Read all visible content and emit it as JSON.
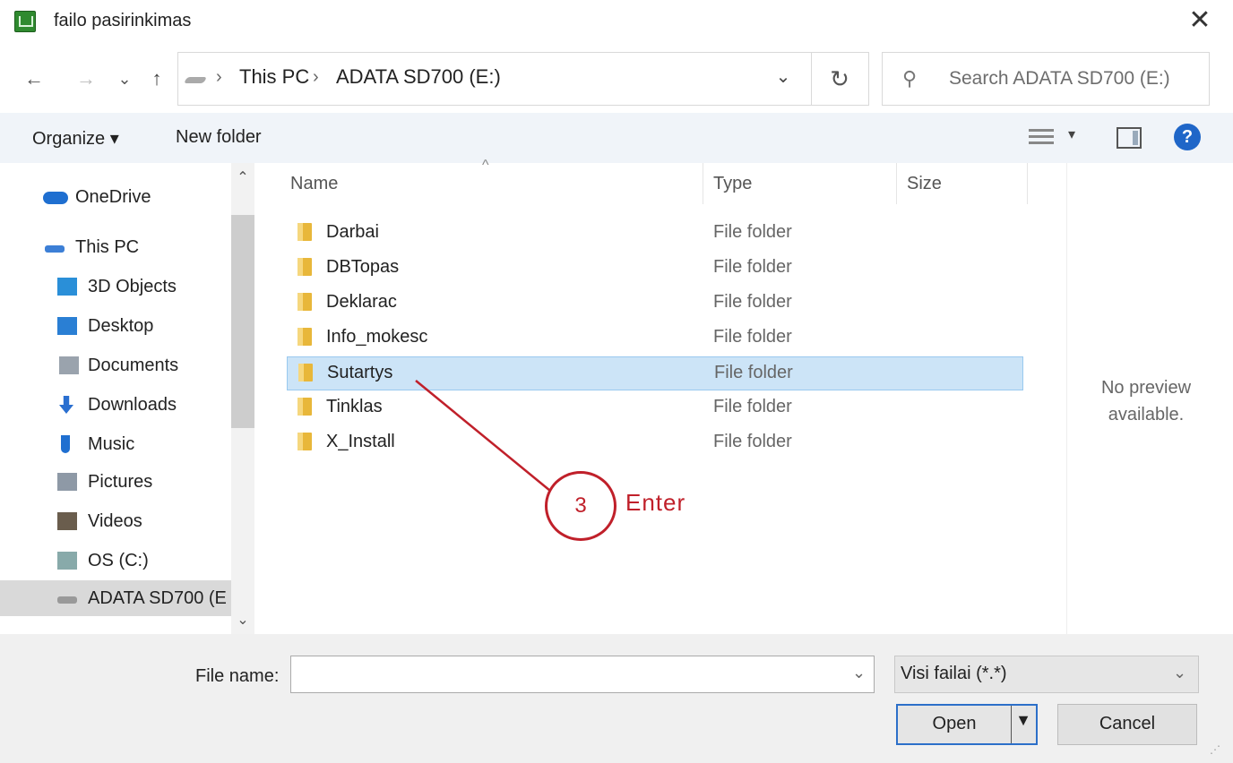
{
  "window": {
    "title": "failo pasirinkimas",
    "close_glyph": "✕"
  },
  "nav": {
    "back_glyph": "←",
    "forward_glyph": "→",
    "recent_glyph": "⌄",
    "up_glyph": "↑",
    "breadcrumbs": [
      "This PC",
      "ADATA SD700 (E:)"
    ],
    "separator": "›",
    "dropdown_glyph": "⌄",
    "refresh_glyph": "↻",
    "search_placeholder": "Search ADATA SD700 (E:)",
    "search_glyph": "⚲"
  },
  "toolbar": {
    "organize_label": "Organize ▾",
    "new_folder_label": "New folder",
    "view_drop_glyph": "▾",
    "help_label": "?"
  },
  "sidebar": {
    "items": [
      {
        "label": "OneDrive",
        "icon": "cloud-icon",
        "color": "#1f6fd0"
      },
      {
        "label": "This PC",
        "icon": "pc-icon",
        "color": "#3c7fd6"
      },
      {
        "label": "3D Objects",
        "icon": "cube-icon",
        "color": "#2a8fd8"
      },
      {
        "label": "Desktop",
        "icon": "desktop-icon",
        "color": "#2a7fd4"
      },
      {
        "label": "Documents",
        "icon": "document-icon",
        "color": "#9aa3ad"
      },
      {
        "label": "Downloads",
        "icon": "download-icon",
        "color": "#2a6fd0"
      },
      {
        "label": "Music",
        "icon": "music-icon",
        "color": "#1f6fd0"
      },
      {
        "label": "Pictures",
        "icon": "pictures-icon",
        "color": "#8e99a6"
      },
      {
        "label": "Videos",
        "icon": "videos-icon",
        "color": "#6a5d4d"
      },
      {
        "label": "OS (C:)",
        "icon": "drive-c-icon",
        "color": "#8aa"
      },
      {
        "label": "ADATA SD700 (E",
        "icon": "drive-e-icon",
        "color": "#999"
      }
    ],
    "scroll_up": "⌃",
    "scroll_down": "⌄"
  },
  "filelist": {
    "columns": [
      "Name",
      "Type",
      "Size"
    ],
    "sort_caret": "^",
    "rows": [
      {
        "name": "Darbai",
        "type": "File folder"
      },
      {
        "name": "DBTopas",
        "type": "File folder"
      },
      {
        "name": "Deklarac",
        "type": "File folder"
      },
      {
        "name": "Info_mokesc",
        "type": "File folder"
      },
      {
        "name": "Sutartys",
        "type": "File folder",
        "selected": true
      },
      {
        "name": "Tinklas",
        "type": "File folder"
      },
      {
        "name": "X_Install",
        "type": "File folder"
      }
    ],
    "preview_text_1": "No preview",
    "preview_text_2": "available."
  },
  "annotation": {
    "number": "3",
    "text": "Enter",
    "color": "#c0202a"
  },
  "bottom": {
    "file_name_label": "File name:",
    "file_name_value": "",
    "file_name_drop": "⌄",
    "filter_value": "Visi failai (*.*)",
    "filter_drop": "⌄",
    "open_label": "Open",
    "open_drop": "▼",
    "cancel_label": "Cancel",
    "grip": "⋰"
  }
}
